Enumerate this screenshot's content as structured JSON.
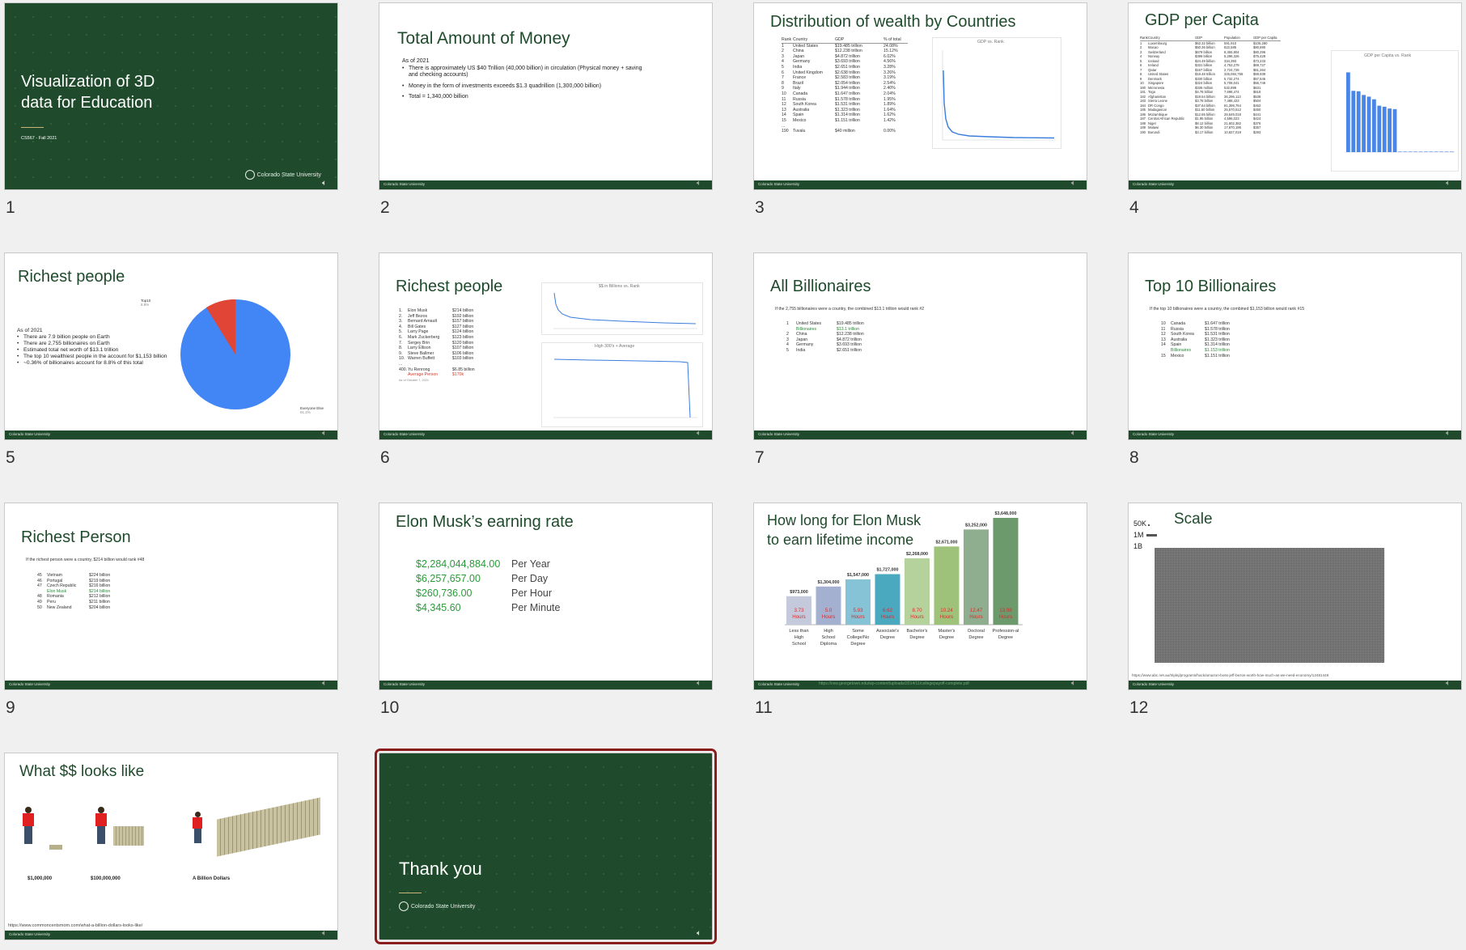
{
  "colors": {
    "brand_green": "#1f4b2c",
    "selected_outline": "#8a1c1c",
    "accent_green": "#2a8a3a",
    "accent_red": "#d83a2a"
  },
  "common": {
    "csu": "Colorado State University",
    "audio_icon": "speaker-icon"
  },
  "slides": [
    {
      "num": "1",
      "title_line1": "Visualization of 3D",
      "title_line2": "data for Education",
      "subtitle": "CS567 - Fall 2021"
    },
    {
      "num": "2",
      "title": "Total Amount of Money",
      "as_of": "As of 2021",
      "bullets": [
        "There is approximately US $40 Trillion (40,000 billion) in circulation (Physical money + saving and checking accounts)",
        "Money in the form of investments exceeds $1.3 quadrillion (1,300,000 billion)",
        "Total = 1,340,000 billion"
      ]
    },
    {
      "num": "3",
      "title": "Distribution of wealth by Countries",
      "headers": [
        "Rank",
        "Country",
        "GDP",
        "% of total"
      ],
      "rows": [
        [
          "1",
          "United States",
          "$19.485 trillion",
          "24.08%"
        ],
        [
          "2",
          "China",
          "$12.238 trillion",
          "15.12%"
        ],
        [
          "3",
          "Japan",
          "$4.872 trillion",
          "6.02%"
        ],
        [
          "4",
          "Germany",
          "$3.693 trillion",
          "4.56%"
        ],
        [
          "5",
          "India",
          "$2.651 trillion",
          "3.28%"
        ],
        [
          "6",
          "United Kingdom",
          "$2.638 trillion",
          "3.26%"
        ],
        [
          "7",
          "France",
          "$2.583 trillion",
          "3.19%"
        ],
        [
          "8",
          "Brazil",
          "$2.054 trillion",
          "2.54%"
        ],
        [
          "9",
          "Italy",
          "$1.944 trillion",
          "2.40%"
        ],
        [
          "10",
          "Canada",
          "$1.647 trillion",
          "2.04%"
        ],
        [
          "11",
          "Russia",
          "$1.578 trillion",
          "1.95%"
        ],
        [
          "12",
          "South Korea",
          "$1.531 trillion",
          "1.89%"
        ],
        [
          "13",
          "Australia",
          "$1.323 trillion",
          "1.64%"
        ],
        [
          "14",
          "Spain",
          "$1.314 trillion",
          "1.62%"
        ],
        [
          "15",
          "Mexico",
          "$1.151 trillion",
          "1.42%"
        ],
        [
          "...",
          "",
          "",
          ""
        ],
        [
          "190",
          "Tuvalu",
          "$40 million",
          "0.00%"
        ]
      ],
      "chart_title": "GDP vs. Rank"
    },
    {
      "num": "4",
      "title": "GDP per Capita",
      "headers": [
        "Rank",
        "Country",
        "GDP",
        "Population",
        "GDP per Capita"
      ],
      "chart_title": "GDP per Capita vs. Rank",
      "rows": [
        [
          "1",
          "Luxembourg",
          "$62.32 billion",
          "591,910",
          "$105,280"
        ],
        [
          "2",
          "Macao",
          "$50.36 billion",
          "622,585",
          "$80,890"
        ],
        [
          "3",
          "Switzerland",
          "$679 billion",
          "8,455,804",
          "$80,296"
        ],
        [
          "4",
          "Norway",
          "$399 billion",
          "5,296,326",
          "$75,428"
        ],
        [
          "5",
          "Iceland",
          "$24.49 billion",
          "334,393",
          "$73,233"
        ],
        [
          "6",
          "Ireland",
          "$331 billion",
          "4,753,279",
          "$69,727"
        ],
        [
          "7",
          "Qatar",
          "$167 billion",
          "2,724,728",
          "$61,264"
        ],
        [
          "8",
          "United States",
          "$19.48 trillion",
          "325,084,756",
          "$59,939"
        ],
        [
          "9",
          "Denmark",
          "$330 billion",
          "5,732,274",
          "$57,545"
        ],
        [
          "10",
          "Singapore",
          "$324 billion",
          "5,708,041",
          "$56,746"
        ],
        [
          "180",
          "Micronesia",
          "$336 million",
          "532,899",
          "$631"
        ],
        [
          "181",
          "Togo",
          "$4.78 billion",
          "7,698,474",
          "$618"
        ],
        [
          "182",
          "Afghanistan",
          "$19.54 billion",
          "36,296,113",
          "$538"
        ],
        [
          "183",
          "Sierra Leone",
          "$3.78 billion",
          "7,488,423",
          "$504"
        ],
        [
          "184",
          "DR Congo",
          "$37.64 billion",
          "81,398,764",
          "$462"
        ],
        [
          "185",
          "Madagascar",
          "$11.50 billion",
          "25,570,512",
          "$450"
        ],
        [
          "186",
          "Mozambique",
          "$12.65 billion",
          "28,649,018",
          "$441"
        ],
        [
          "187",
          "Central African Republic",
          "$1.95 billion",
          "4,596,023",
          "$424"
        ],
        [
          "188",
          "Niger",
          "$8.12 billion",
          "21,602,382",
          "$376"
        ],
        [
          "189",
          "Malawi",
          "$6.30 billion",
          "17,670,196",
          "$357"
        ],
        [
          "190",
          "Burundi",
          "$3.17 billion",
          "10,827,019",
          "$293"
        ]
      ]
    },
    {
      "num": "5",
      "title": "Richest people",
      "as_of": "As of 2021",
      "bullets": [
        "There are 7.9 billion people on Earth",
        "There are 2,755 billionaires on Earth",
        "Estimated total net worth of $13.1 trillion",
        "The top 10 wealthiest people in the  account for $1,153 billion",
        "~0.36% of billionaires account for 8.8% of this total"
      ],
      "pie_label_a": "Top10",
      "pie_pct_a": "8.8%",
      "pie_label_b": "Everyone Else",
      "pie_pct_b": "91.2%"
    },
    {
      "num": "6",
      "title": "Richest people",
      "chart1_title": "$$ in Billions vs. Rank",
      "chart2_title": "High 300's + Average",
      "rows": [
        [
          "1.",
          "Elon Musk",
          "$214 billion"
        ],
        [
          "2.",
          "Jeff Bezos",
          "$192 billion"
        ],
        [
          "3.",
          "Bernard Arnault",
          "$157 billion"
        ],
        [
          "4.",
          "Bill Gates",
          "$127 billion"
        ],
        [
          "5.",
          "Larry Page",
          "$124 billion"
        ],
        [
          "6.",
          "Mark Zuckerberg",
          "$123 billion"
        ],
        [
          "7.",
          "Sergey Brin",
          "$120 billion"
        ],
        [
          "8.",
          "Larry Ellison",
          "$107 billion"
        ],
        [
          "9.",
          "Steve Ballmer",
          "$106 billion"
        ],
        [
          "10.",
          "Warren Buffett",
          "$103 billion"
        ]
      ],
      "ellipsis": "...",
      "row400": [
        "400.",
        "Yu Renrong",
        "$6.85 billion"
      ],
      "avg": [
        "",
        "Average Person",
        "$170k"
      ],
      "date_note": "As of October 7, 2021"
    },
    {
      "num": "7",
      "title": "All Billionaires",
      "intro": "If the 2,755 billionaires were a country, the combined $13.1 trillion would rank #2",
      "rows": [
        [
          "1",
          "United States",
          "$19.485 trillion",
          "n"
        ],
        [
          "",
          "Billionaires",
          "$13.1 trillion",
          "g"
        ],
        [
          "2",
          "China",
          "$12.238 trillion",
          "n"
        ],
        [
          "3",
          "Japan",
          "$4.872 trillion",
          "n"
        ],
        [
          "4",
          "Germany",
          "$3.693 trillion",
          "n"
        ],
        [
          "5",
          "India",
          "$2.651 trillion",
          "n"
        ]
      ]
    },
    {
      "num": "8",
      "title": "Top 10 Billionaires",
      "intro": "If the top 10 billionaires were a country, the combined $1,153 billion would rank #15",
      "rows": [
        [
          "10",
          "Canada",
          "$1.647 trillion",
          "n"
        ],
        [
          "11",
          "Russia",
          "$1.578 trillion",
          "n"
        ],
        [
          "12",
          "South Korea",
          "$1.531 trillion",
          "n"
        ],
        [
          "13",
          "Australia",
          "$1.323 trillion",
          "n"
        ],
        [
          "14",
          "Spain",
          "$1.314 trillion",
          "n"
        ],
        [
          "",
          "Billionaires",
          "$1.153 trillion",
          "g"
        ],
        [
          "15",
          "Mexico",
          "$1.151 trillion",
          "n"
        ]
      ]
    },
    {
      "num": "9",
      "title": "Richest Person",
      "intro": "If the richest person were a country, $214 billion would rank #48",
      "rows": [
        [
          "45",
          "Vietnam",
          "$224 billion",
          "n"
        ],
        [
          "46",
          "Portugal",
          "$219 billion",
          "n"
        ],
        [
          "47",
          "Czech Republic",
          "$216 billion",
          "n"
        ],
        [
          "",
          "Elon Musk",
          "$214 billion",
          "g"
        ],
        [
          "48",
          "Romania",
          "$212 billion",
          "n"
        ],
        [
          "49",
          "Peru",
          "$211 billion",
          "n"
        ],
        [
          "50",
          "New Zealand",
          "$204 billion",
          "n"
        ]
      ]
    },
    {
      "num": "10",
      "title": "Elon Musk’s earning rate",
      "rows": [
        [
          "$2,284,044,884.00",
          "Per Year"
        ],
        [
          "$6,257,657.00",
          "Per Day"
        ],
        [
          "$260,736.00",
          "Per Hour"
        ],
        [
          "$4,345.60",
          "Per Minute"
        ]
      ]
    },
    {
      "num": "11",
      "title_line1": "How long for Elon Musk",
      "title_line2": "to earn lifetime income",
      "source": "https://cew.georgetown.edu/wp-content/uploads/2014/11/collegepayoff-complete.pdf",
      "chart_data": {
        "type": "bar",
        "categories": [
          "Less than High School",
          "High School Diploma",
          "Some College/No Degree",
          "Associate's Degree",
          "Bachelor's Degree",
          "Master's Degree",
          "Doctoral Degree",
          "Profession-al Degree"
        ],
        "values": [
          973000,
          1304000,
          1547000,
          1727000,
          2268000,
          2671000,
          3252000,
          3648000
        ],
        "value_labels": [
          "$973,000",
          "$1,304,000",
          "$1,547,000",
          "$1,727,000",
          "$2,268,000",
          "$2,671,000",
          "$3,252,000",
          "$3,648,000"
        ],
        "hours": [
          "3.73",
          "5.0",
          "5.93",
          "6.62",
          "8.70",
          "10.24",
          "12.47",
          "13.98"
        ],
        "hours_unit": "Hours",
        "colors": [
          "#c4c9db",
          "#a4b0cf",
          "#86c3d6",
          "#4aa8bf",
          "#b5d19c",
          "#9fc27a",
          "#8fae8f",
          "#6d9a6d"
        ],
        "title": "",
        "xlabel": "",
        "ylabel": ""
      }
    },
    {
      "num": "12",
      "title": "Scale",
      "labels": [
        "50K",
        "1M",
        "1B"
      ],
      "source": "https://www.abc.net.au/triplej/programs/hack/amazon-boss-jeff-bezos-worth-how-much-as-we-need-economy/12481446"
    },
    {
      "num": "13",
      "title": "What $$ looks like",
      "captions": [
        "$1,000,000",
        "$100,000,000",
        "A Billion Dollars"
      ],
      "source": "https://www.commoncentsmom.com/what-a-billion-dollars-looks-like/"
    },
    {
      "num": "14",
      "title": "Thank you"
    }
  ]
}
